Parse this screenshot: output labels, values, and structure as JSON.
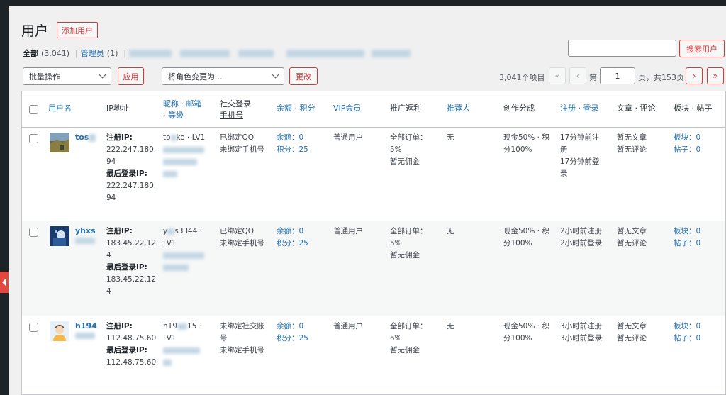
{
  "page": {
    "title": "用户",
    "add_button": "添加用户"
  },
  "views": {
    "all_label": "全部",
    "all_count": "(3,041)",
    "admin_label": "管理员",
    "admin_count": "(1)"
  },
  "search": {
    "button": "搜索用户",
    "value": ""
  },
  "toolbar": {
    "bulk_select": "批量操作",
    "apply_button": "应用",
    "role_select": "将角色变更为...",
    "change_button": "更改"
  },
  "pagination": {
    "items": "3,041个项目",
    "first": "«",
    "prev": "‹",
    "page_prefix": "第",
    "current": "1",
    "page_suffix": "页，共153页",
    "next": "›",
    "last": "»"
  },
  "columns": {
    "username": "用户名",
    "ip": "IP地址",
    "nick_a": "昵称 · 邮箱",
    "nick_b": "· 等级",
    "social_a": "社交登录 ·",
    "social_b": "手机号",
    "balance": "余额 · 积分",
    "vip": "VIP会员",
    "promo": "推广返利",
    "referrer": "推荐人",
    "creator": "创作分成",
    "register": "注册 · 登录",
    "posts": "文章 · 评论",
    "forum": "板块 · 帖子"
  },
  "users": [
    {
      "username": "tos",
      "avatar": "landscape-photo-avatar",
      "reg_ip_label": "注册IP:",
      "reg_ip_a": "222.247.180.",
      "reg_ip_b": "94",
      "last_ip_label": "最后登录IP:",
      "last_ip_a": "222.247.180.",
      "last_ip_b": "94",
      "nick_a": "to",
      "nick_b": "ko · LV1",
      "social_qq": "已绑定QQ",
      "social_phone": "未绑定手机号",
      "balance": "余额：0",
      "points": "积分：25",
      "vip": "普通用户",
      "promo_a": "全部订单：",
      "promo_b": "5%",
      "promo_c": "暂无佣金",
      "referrer": "无",
      "creator_a": "现金50% · 积",
      "creator_b": "分100%",
      "reg_a": "17分钟前注",
      "reg_b": "册",
      "login_a": "17分钟前登",
      "login_b": "录",
      "posts": "暂无文章",
      "comments": "暂无评论",
      "forums": "板块：0",
      "topics": "帖子：0"
    },
    {
      "username": "yhxs",
      "avatar": "dark-blue-photo-avatar",
      "reg_ip_label": "注册IP:",
      "reg_ip_a": "183.45.22.12",
      "reg_ip_b": "4",
      "last_ip_label": "最后登录IP:",
      "last_ip_a": "183.45.22.12",
      "last_ip_b": "4",
      "nick_a": "y",
      "nick_b": "s3344 ·",
      "nick_c": "LV1",
      "social_qq": "已绑定QQ",
      "social_phone": "未绑定手机号",
      "balance": "余额：0",
      "points": "积分：25",
      "vip": "普通用户",
      "promo_a": "全部订单：",
      "promo_b": "5%",
      "promo_c": "暂无佣金",
      "referrer": "无",
      "creator_a": "现金50% · 积",
      "creator_b": "分100%",
      "reg_a": "2小时前注册",
      "login_a": "2小时前登录",
      "posts": "暂无文章",
      "comments": "暂无评论",
      "forums": "板块：0",
      "topics": "帖子：0"
    },
    {
      "username": "h194",
      "avatar": "cartoon-person-avatar",
      "reg_ip_label": "注册IP:",
      "reg_ip_a": "112.48.75.60",
      "last_ip_label": "最后登录IP:",
      "last_ip_a": "112.48.75.60",
      "nick_a": "h19",
      "nick_b": "15 ·",
      "nick_c": "LV1",
      "social_qq": "未绑定社交账",
      "social_qq_b": "号",
      "social_phone": "未绑定手机号",
      "balance": "余额：0",
      "points": "积分：25",
      "vip": "普通用户",
      "promo_a": "全部订单：",
      "promo_b": "5%",
      "promo_c": "暂无佣金",
      "referrer": "无",
      "creator_a": "现金50% · 积",
      "creator_b": "分100%",
      "reg_a": "3小时前注册",
      "login_a": "3小时前登录",
      "posts": "暂无文章",
      "comments": "暂无评论",
      "forums": "板块：0",
      "topics": "帖子：0"
    }
  ]
}
